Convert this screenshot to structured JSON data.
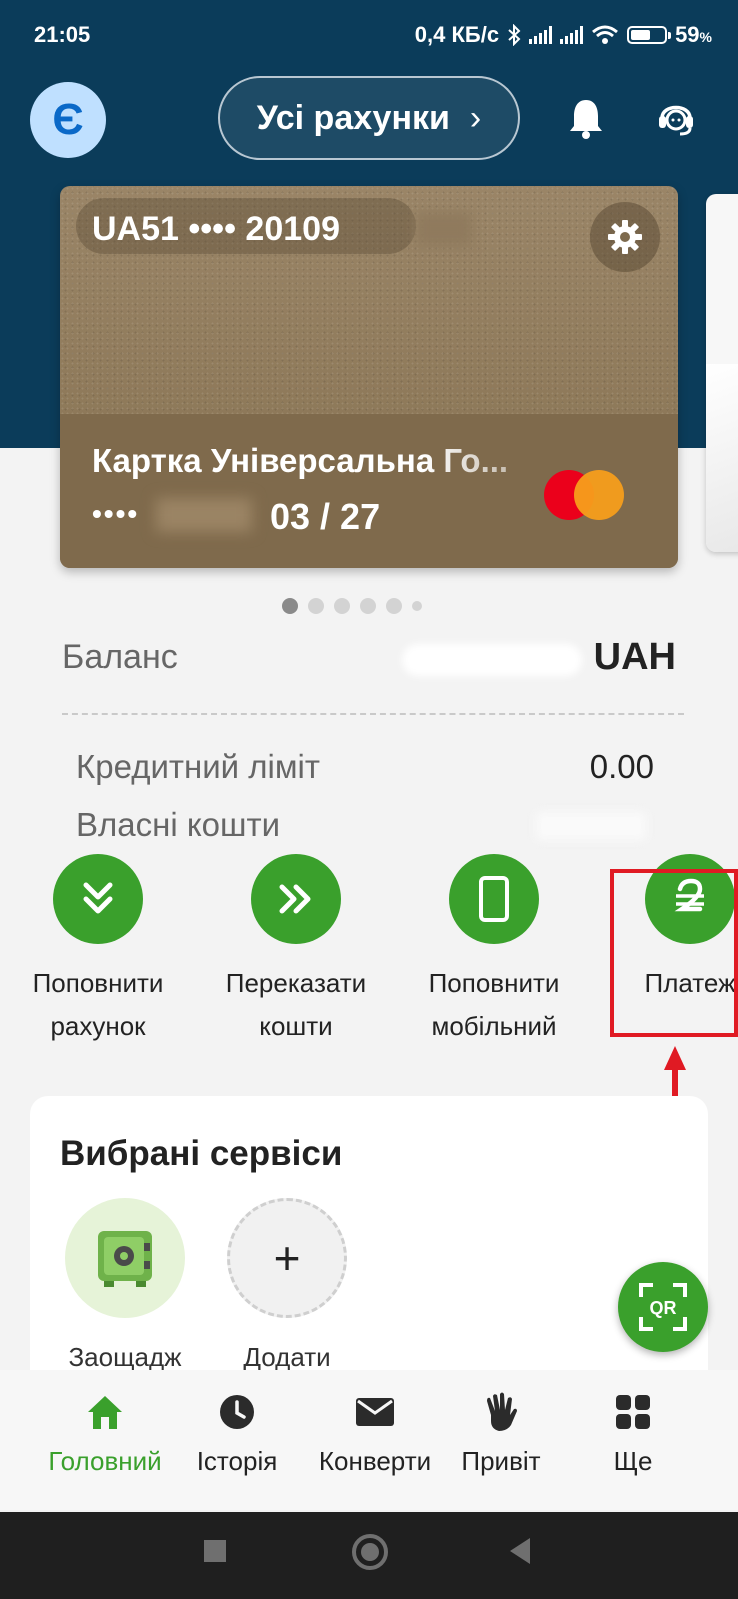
{
  "status_bar": {
    "time": "21:05",
    "speed": "0,4 КБ/с",
    "battery_percent": "59",
    "battery_level": 0.59
  },
  "header": {
    "avatar_letter": "Є",
    "accounts_label": "Усі рахунки",
    "bell_icon": "bell-icon",
    "support_icon": "support-headset-icon"
  },
  "card": {
    "iban": "UA51 •••• 20109",
    "name": "Картка Універсальна Го...",
    "number_mask": "••••",
    "expiry": "03 / 27",
    "brand": "mastercard",
    "colors": {
      "card_gold": "#8c7757",
      "header_bg": "#0b3c5a"
    }
  },
  "pager": {
    "count": 6,
    "active_index": 0
  },
  "balance": {
    "label": "Баланс",
    "currency": "UAH",
    "credit_limit_label": "Кредитний ліміт",
    "credit_limit_value": "0.00",
    "own_funds_label": "Власні кошти"
  },
  "actions": [
    {
      "line1": "Поповнити",
      "line2": "рахунок",
      "icon": "double-chevron-down-icon"
    },
    {
      "line1": "Переказати",
      "line2": "кошти",
      "icon": "double-chevron-right-icon"
    },
    {
      "line1": "Поповнити",
      "line2": "мобільний",
      "icon": "smartphone-icon"
    },
    {
      "line1": "Платеж",
      "line2": "",
      "icon": "hryvnia-icon"
    }
  ],
  "favorites": {
    "title": "Вибрані сервіси",
    "items": [
      {
        "label": "Заощадж",
        "icon": "safe-icon"
      },
      {
        "label": "Додати",
        "icon": "plus-icon"
      }
    ],
    "qr_label": "QR"
  },
  "bottom_nav": [
    {
      "label": "Головний",
      "icon": "home-icon",
      "active": true
    },
    {
      "label": "Історія",
      "icon": "clock-icon",
      "active": false
    },
    {
      "label": "Конверти",
      "icon": "envelope-icon",
      "active": false
    },
    {
      "label": "Привіт",
      "icon": "wave-hand-icon",
      "active": false
    },
    {
      "label": "Ще",
      "icon": "grid-icon",
      "active": false
    }
  ],
  "accent_color": "#3aa02c",
  "highlight_color": "#e01a23"
}
